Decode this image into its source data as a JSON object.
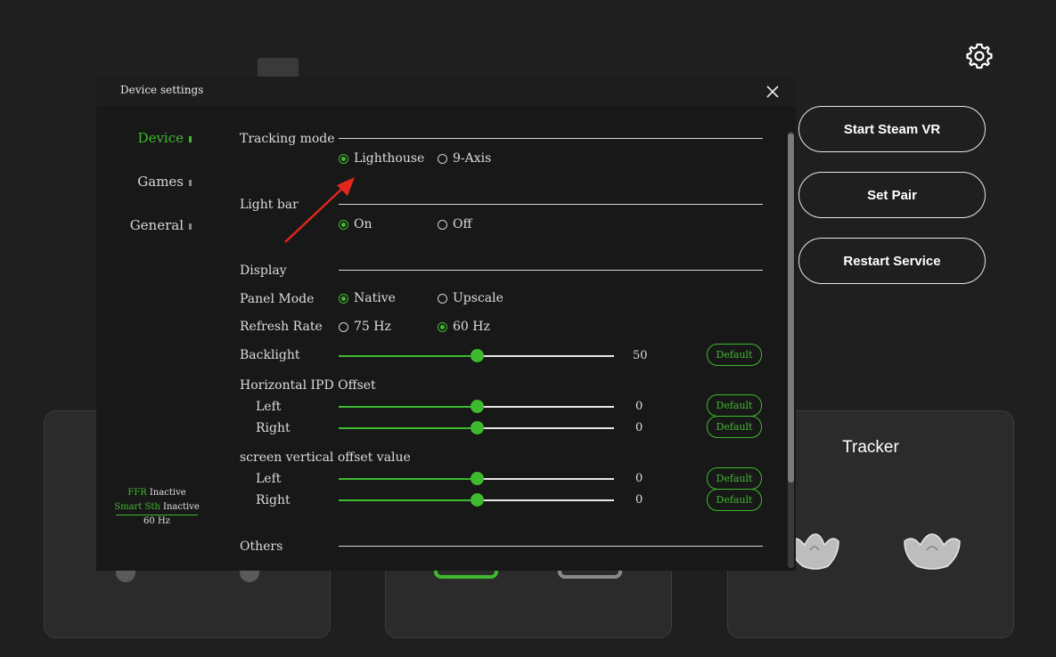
{
  "main": {
    "buttons": {
      "start_steam_vr": "Start Steam VR",
      "set_pair": "Set Pair",
      "restart_service": "Restart Service"
    },
    "tracker_card": {
      "title": "Tracker"
    },
    "settings_icon": "gear-icon"
  },
  "dialog": {
    "title": "Device settings",
    "nav": [
      {
        "label": "Device",
        "active": true
      },
      {
        "label": "Games",
        "active": false
      },
      {
        "label": "General",
        "active": false
      }
    ],
    "status": {
      "ffr_label": "FFR",
      "ffr_state": "Inactive",
      "smart_label": "Smart Sth",
      "smart_state": "Inactive",
      "refresh": "60 Hz"
    },
    "sections": {
      "tracking_mode": {
        "label": "Tracking mode",
        "options": [
          "Lighthouse",
          "9-Axis"
        ],
        "selected": "Lighthouse"
      },
      "light_bar": {
        "label": "Light bar",
        "options": [
          "On",
          "Off"
        ],
        "selected": "On"
      },
      "display": {
        "label": "Display",
        "panel_mode": {
          "label": "Panel Mode",
          "options": [
            "Native",
            "Upscale"
          ],
          "selected": "Native"
        },
        "refresh_rate": {
          "label": "Refresh Rate",
          "options": [
            "75 Hz",
            "60 Hz"
          ],
          "selected": "60 Hz"
        },
        "backlight": {
          "label": "Backlight",
          "value": "50",
          "fraction": 0.5
        }
      },
      "horizontal_ipd": {
        "label": "Horizontal IPD Offset",
        "left": {
          "label": "Left",
          "value": "0",
          "fraction": 0.5
        },
        "right": {
          "label": "Right",
          "value": "0",
          "fraction": 0.5
        }
      },
      "vertical_offset": {
        "label": "screen vertical offset value",
        "left": {
          "label": "Left",
          "value": "0",
          "fraction": 0.5
        },
        "right": {
          "label": "Right",
          "value": "0",
          "fraction": 0.5
        }
      },
      "others": {
        "label": "Others"
      }
    },
    "default_label": "Default"
  },
  "colors": {
    "accent": "#3dba2d",
    "background": "#1f1f1f",
    "dialog": "#181818",
    "annotation_arrow": "#e3271c"
  }
}
